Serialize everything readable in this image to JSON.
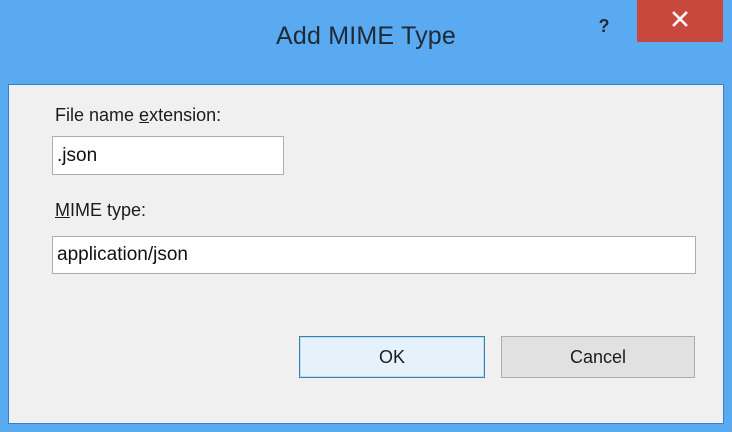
{
  "dialog": {
    "title": "Add MIME Type",
    "help_label": "?",
    "close_icon": "close-icon"
  },
  "form": {
    "extension_label_pre": "File name ",
    "extension_label_mnemonic": "e",
    "extension_label_post": "xtension:",
    "extension_value": ".json",
    "mime_label_mnemonic": "M",
    "mime_label_post": "IME type:",
    "mime_value": "application/json"
  },
  "buttons": {
    "ok_label": "OK",
    "cancel_label": "Cancel"
  },
  "colors": {
    "titlebar": "#5aaaf2",
    "close_button": "#c9483e",
    "client_background": "#f0f0f0",
    "default_button": "#e5f1fb"
  }
}
